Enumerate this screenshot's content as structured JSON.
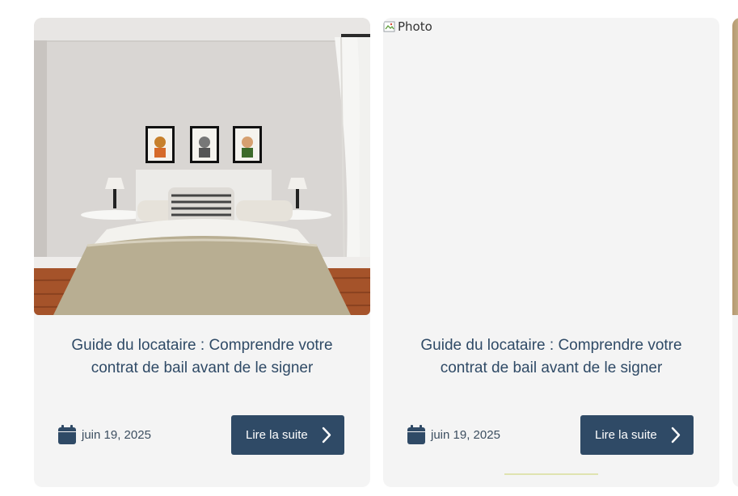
{
  "cards": [
    {
      "title": "Guide du locataire : Comprendre votre contrat de bail avant de le signer",
      "date": "juin 19, 2025",
      "button_label": "Lire la suite",
      "image": "bedroom-photo"
    },
    {
      "title": "Guide du locataire : Comprendre votre contrat de bail avant de le signer",
      "date": "juin 19, 2025",
      "button_label": "Lire la suite",
      "image_alt": "Photo"
    }
  ],
  "colors": {
    "card_bg": "#f4f4f4",
    "accent": "#2f4a66",
    "progress": "#dfe3b0"
  }
}
